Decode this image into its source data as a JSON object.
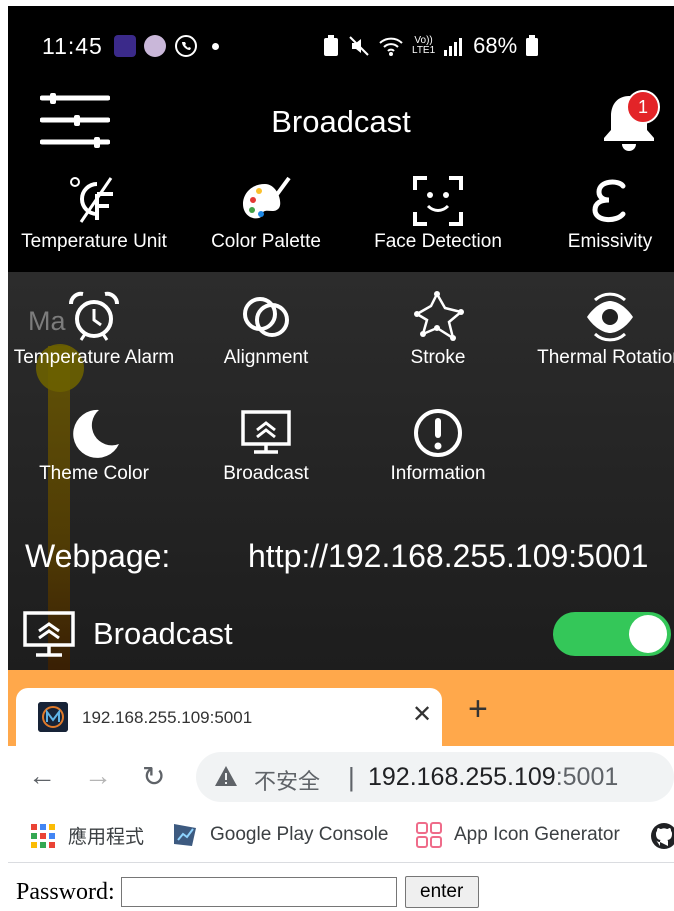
{
  "status_bar": {
    "time": "11:45",
    "battery_percent": "68%",
    "lte_label": "LTE1",
    "volte_label": "Vo))"
  },
  "header": {
    "title": "Broadcast",
    "notification_count": "1"
  },
  "menu": {
    "items": [
      {
        "label": "Temperature Unit",
        "icon": "temperature-unit-icon"
      },
      {
        "label": "Color Palette",
        "icon": "palette-icon"
      },
      {
        "label": "Face Detection",
        "icon": "face-detection-icon"
      },
      {
        "label": "Emissivity",
        "icon": "epsilon-icon"
      },
      {
        "label": "Temperature Alarm",
        "icon": "alarm-clock-icon"
      },
      {
        "label": "Alignment",
        "icon": "alignment-circles-icon"
      },
      {
        "label": "Stroke",
        "icon": "stroke-network-icon"
      },
      {
        "label": "Thermal Rotation",
        "icon": "rotate-eye-icon"
      },
      {
        "label": "Theme Color",
        "icon": "moon-icon"
      },
      {
        "label": "Broadcast",
        "icon": "broadcast-screen-icon"
      },
      {
        "label": "Information",
        "icon": "info-icon"
      }
    ]
  },
  "background_ghost_text": "Ma",
  "webpage": {
    "label": "Webpage:",
    "url": "http://192.168.255.109:5001"
  },
  "broadcast_row": {
    "label": "Broadcast",
    "enabled": true
  },
  "browser": {
    "tab_title": "192.168.255.109:5001",
    "insecure_label": "不安全",
    "separator": "|",
    "url_host": "192.168.255.109",
    "url_port": ":5001",
    "bookmarks": [
      {
        "label": "應用程式",
        "icon": "apps-grid-icon"
      },
      {
        "label": "Google Play Console",
        "icon": "play-console-icon"
      },
      {
        "label": "App Icon Generator",
        "icon": "app-icon-generator-icon"
      }
    ]
  },
  "form": {
    "password_label": "Password:",
    "submit_label": "enter",
    "password_value": ""
  },
  "colors": {
    "toggle_on": "#34c759",
    "tab_strip": "#ffa84b",
    "badge": "#e32428"
  }
}
